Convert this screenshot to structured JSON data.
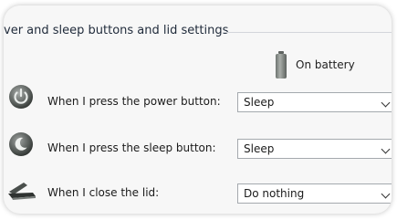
{
  "section": {
    "title": "ver and sleep buttons and lid settings"
  },
  "columns": {
    "battery_label": "On battery",
    "battery_icon": "battery-icon"
  },
  "rows": [
    {
      "label": "When I press the power button:",
      "value": "Sleep",
      "icon": "power-button-icon"
    },
    {
      "label": "When I press the sleep button:",
      "value": "Sleep",
      "icon": "sleep-button-icon"
    },
    {
      "label": "When I close the lid:",
      "value": "Do nothing",
      "icon": "laptop-lid-icon"
    }
  ],
  "colors": {
    "card_background": "#f7f7f7",
    "title_text": "#1f2a3a",
    "select_border": "#a4a9ae"
  }
}
